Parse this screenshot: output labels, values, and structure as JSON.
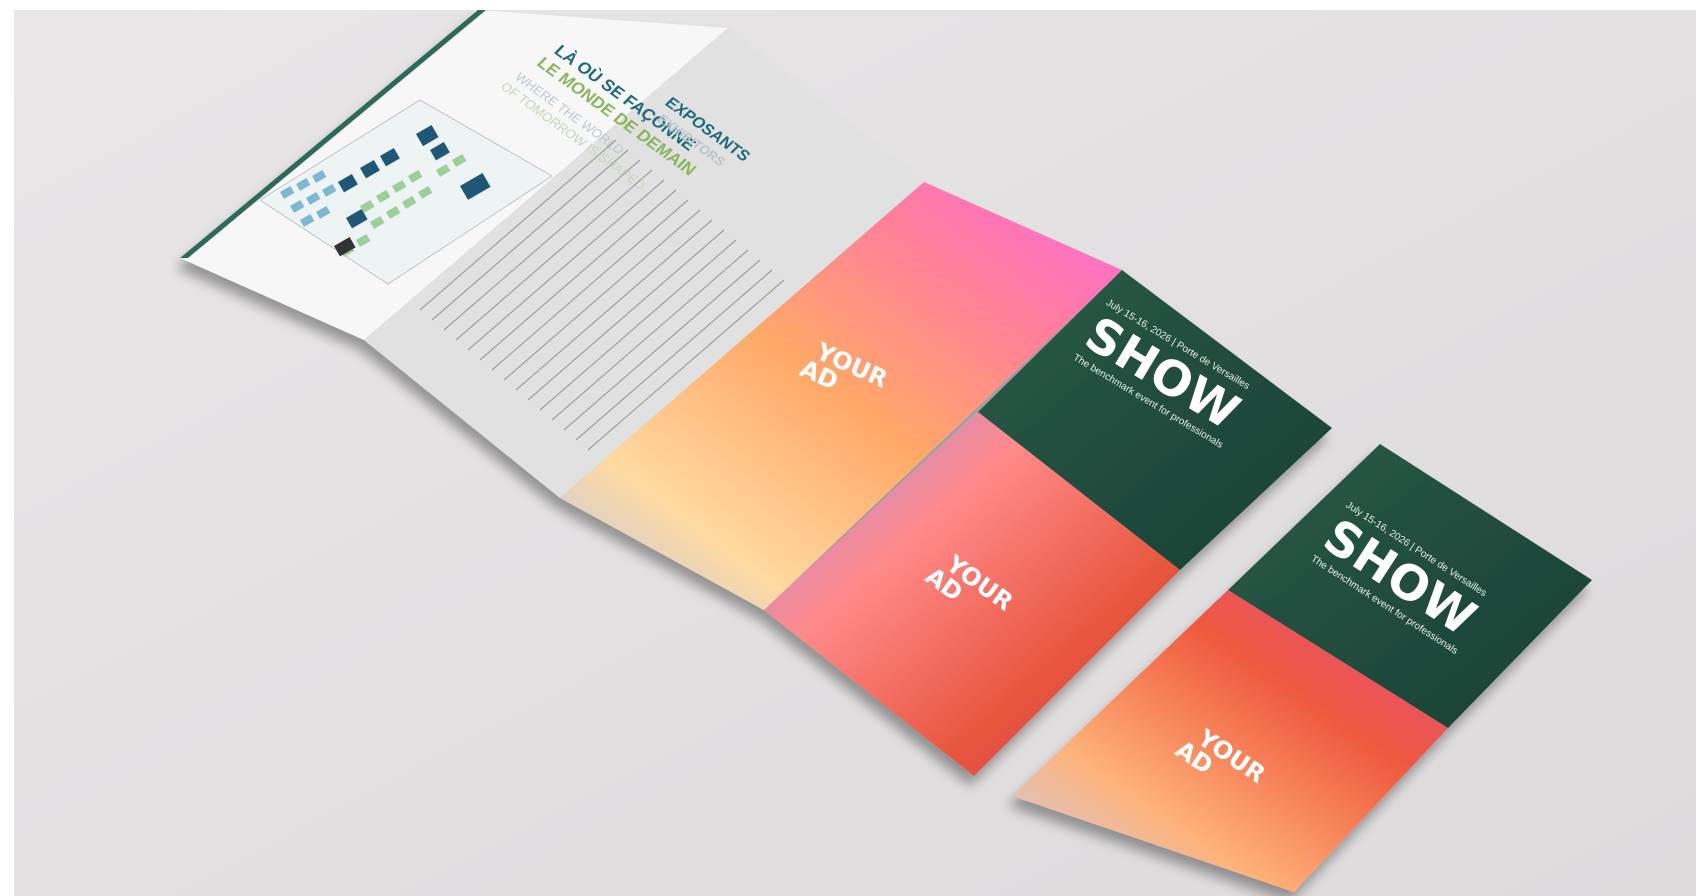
{
  "brochure": {
    "map_panel": {
      "title_fr_line1": "LÀ OÙ SE FAÇONNE",
      "title_fr_line2": "LE MONDE DE DEMAIN",
      "title_en_line1": "WHERE THE WORLD",
      "title_en_line2": "OF TOMORROW IS SHAPED"
    },
    "exhibitors_panel": {
      "heading_fr": "EXPOSANTS",
      "heading_en": "EXHIBITORS"
    },
    "ad_label_line1": "YOUR",
    "ad_label_line2": "AD",
    "cover": {
      "date_line": "July 15-16, 2026 | Porte de Versailles",
      "title": "SHOW",
      "tagline": "The benchmark event for professionals"
    }
  },
  "colors": {
    "background": "#e3e1e2",
    "teal": "#1f6a7c",
    "green_light": "#9cc06a",
    "cover_green": "#1e4b3c",
    "gradient": [
      "#c7b8f0",
      "#ff9a5a",
      "#ff6fd8",
      "#e3464f",
      "#7a63d6"
    ]
  }
}
